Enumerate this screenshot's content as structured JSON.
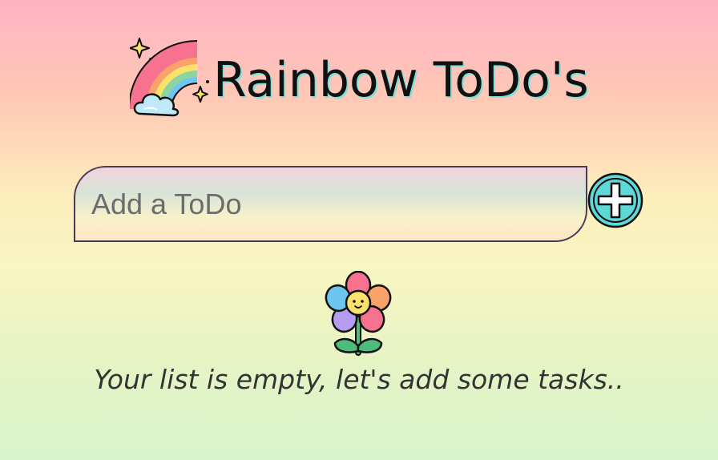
{
  "header": {
    "title": "Rainbow ToDo's",
    "logo_icon": "rainbow-cloud-icon"
  },
  "form": {
    "input_placeholder": "Add a ToDo",
    "input_value": "",
    "add_button_icon": "plus-circle-icon"
  },
  "empty_state": {
    "icon": "flower-icon",
    "message": "Your list is empty, let's add some tasks.."
  },
  "colors": {
    "accent": "#5fd8d8",
    "title_shadow": "#7fe0d8",
    "outline": "#111111"
  }
}
